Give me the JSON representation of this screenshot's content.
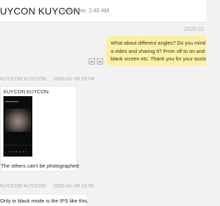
{
  "header": {
    "contact_name": "UYCON KUYCON",
    "local_time": "Local Time: 2:40 AM"
  },
  "messages": [
    {
      "direction": "outgoing",
      "timestamp": "2026-01",
      "lines": [
        "What about different angles? Do you mind t",
        "a video and sharing it? From off to on and th",
        "blank screen etc. Thank you for your assista"
      ],
      "attachment_count": 2
    },
    {
      "direction": "incoming",
      "sender": "KUYCON KUYCON",
      "timestamp": "2026-01-28 16:54",
      "card_title": "KUYCON KUYCON:",
      "caption": "The others can't be photographed"
    },
    {
      "direction": "incoming",
      "sender": "KUYCON KUYCON",
      "timestamp": "2026-01-28 16:55",
      "text": "Only in black mode is the IPS like this."
    }
  ],
  "colors": {
    "outgoing_bubble": "#fcf0a3",
    "incoming_bubble": "#ffffff",
    "background": "#f2f2f2"
  }
}
